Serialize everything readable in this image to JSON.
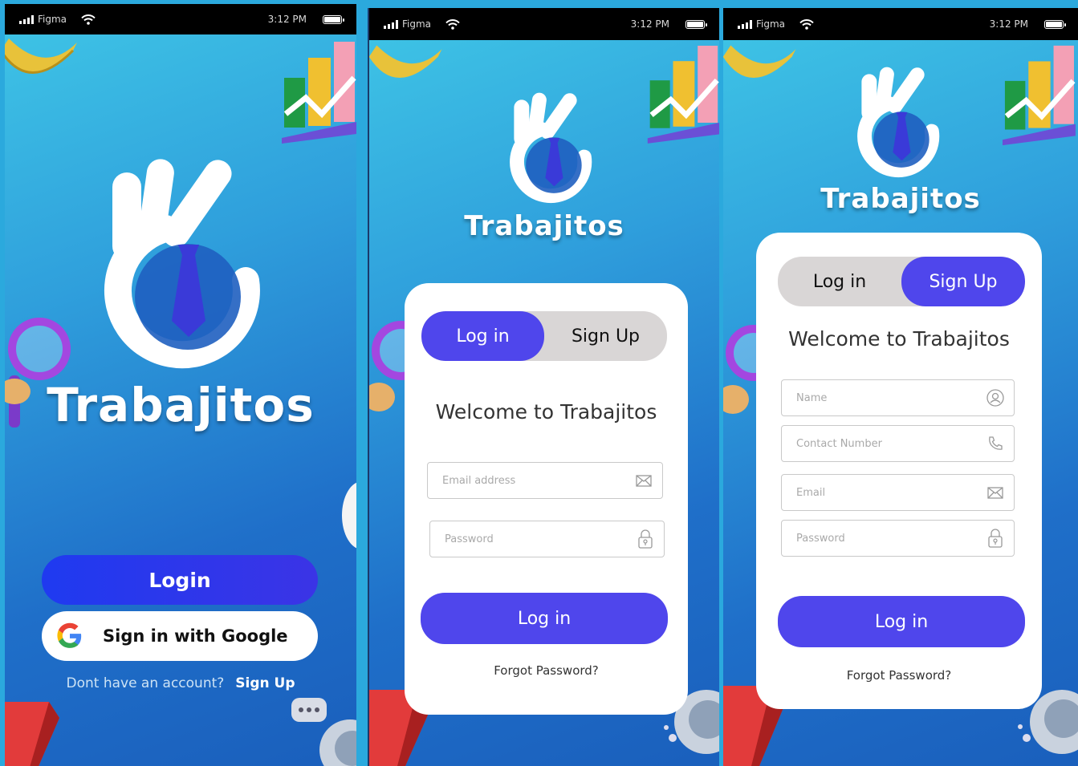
{
  "status_bar": {
    "carrier": "Figma",
    "time": "3:12 PM"
  },
  "brand": {
    "name": "Trabajitos"
  },
  "colors": {
    "primary": "#4f46ec",
    "login_blue": "#2637ee",
    "background": "#2ba9dd",
    "tab_inactive": "#d9d6d6"
  },
  "screen1": {
    "login_label": "Login",
    "google_label": "Sign in with Google",
    "footer_prompt": "Dont have an account?",
    "footer_link": "Sign Up"
  },
  "screen2": {
    "tab_login": "Log in",
    "tab_signup": "Sign Up",
    "active_tab": "login",
    "welcome": "Welcome to Trabajitos",
    "email_placeholder": "Email address",
    "password_placeholder": "Password",
    "submit_label": "Log in",
    "forgot_label": "Forgot Password?"
  },
  "screen3": {
    "tab_login": "Log in",
    "tab_signup": "Sign Up",
    "active_tab": "signup",
    "welcome": "Welcome to Trabajitos",
    "name_placeholder": "Name",
    "contact_placeholder": "Contact Number",
    "email_placeholder": "Email",
    "password_placeholder": "Password",
    "submit_label": "Log in",
    "forgot_label": "Forgot Password?"
  },
  "icons": {
    "signal": "signal-icon",
    "wifi": "wifi-icon",
    "battery": "battery-icon",
    "google": "google-icon",
    "mail": "mail-icon",
    "lock": "lock-icon",
    "user": "user-icon",
    "phone": "phone-icon",
    "logo": "ok-hand-tie-logo"
  }
}
